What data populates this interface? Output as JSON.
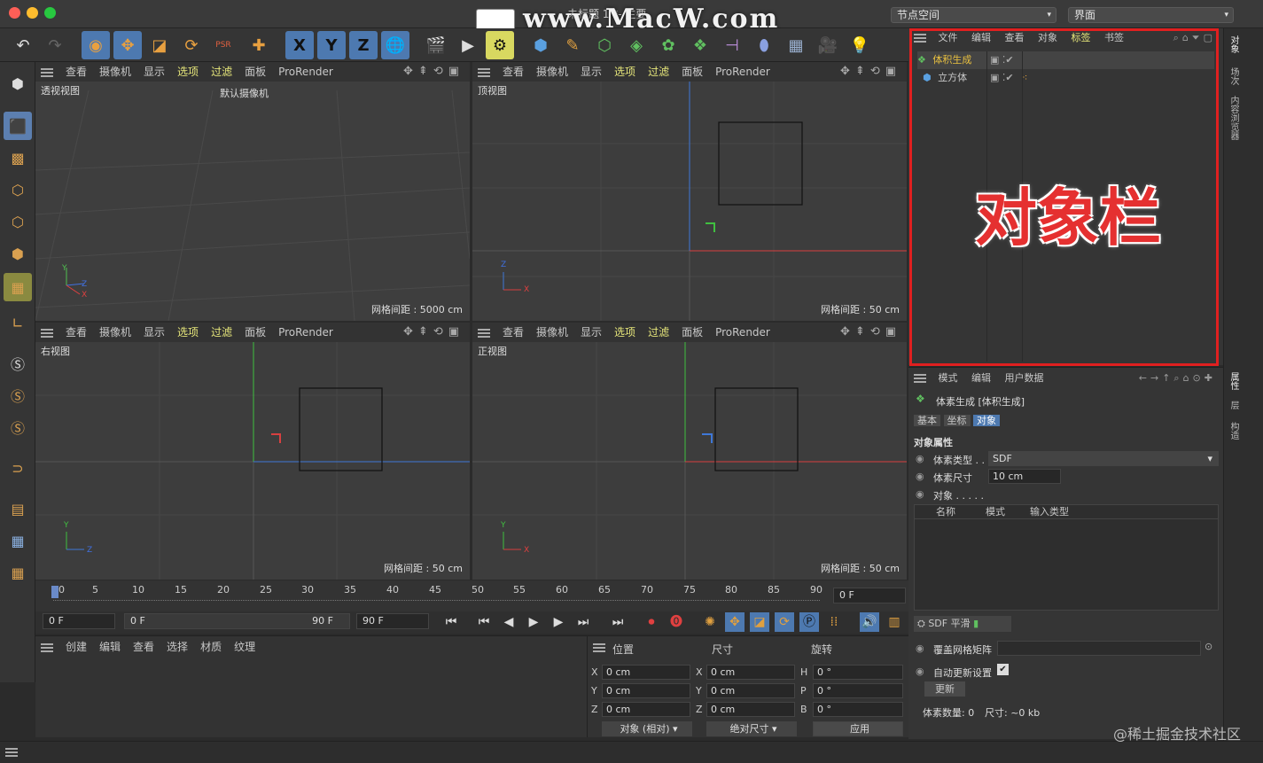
{
  "window": {
    "title": "未标题 1 *- 主要",
    "watermark": "www.MacW.com"
  },
  "header": {
    "node_space": "节点空间",
    "layout": "界面"
  },
  "toolbar": {
    "psr_label": "PSR",
    "x_axis": "X",
    "y_axis": "Y",
    "z_axis": "Z"
  },
  "viewports": [
    {
      "menu": [
        "查看",
        "摄像机",
        "显示",
        "选项",
        "过滤",
        "面板",
        "ProRender"
      ],
      "name": "透视视图",
      "camera": "默认摄像机",
      "grid": "网格间距 : 5000 cm"
    },
    {
      "menu": [
        "查看",
        "摄像机",
        "显示",
        "选项",
        "过滤",
        "面板",
        "ProRender"
      ],
      "name": "顶视图",
      "grid": "网格间距 : 50 cm"
    },
    {
      "menu": [
        "查看",
        "摄像机",
        "显示",
        "选项",
        "过滤",
        "面板",
        "ProRender"
      ],
      "name": "右视图",
      "grid": "网格间距 : 50 cm"
    },
    {
      "menu": [
        "查看",
        "摄像机",
        "显示",
        "选项",
        "过滤",
        "面板",
        "ProRender"
      ],
      "name": "正视图",
      "grid": "网格间距 : 50 cm"
    }
  ],
  "axes": {
    "x": "X",
    "y": "Y",
    "z": "Z"
  },
  "timeline": {
    "ticks": [
      "0",
      "5",
      "10",
      "15",
      "20",
      "25",
      "30",
      "35",
      "40",
      "45",
      "50",
      "55",
      "60",
      "65",
      "70",
      "75",
      "80",
      "85",
      "90"
    ],
    "current": "0 F"
  },
  "transport": {
    "start": "0 F",
    "range_start": "0 F",
    "range_end": "90 F",
    "end": "90 F"
  },
  "material": {
    "menu": [
      "创建",
      "编辑",
      "查看",
      "选择",
      "材质",
      "纹理"
    ]
  },
  "coords": {
    "headers": [
      "位置",
      "尺寸",
      "旋转"
    ],
    "pos": [
      "0 cm",
      "0 cm",
      "0 cm"
    ],
    "size": [
      "0 cm",
      "0 cm",
      "0 cm"
    ],
    "rot": [
      "0 °",
      "0 °",
      "0 °"
    ],
    "rot_labels": [
      "H",
      "P",
      "B"
    ],
    "mode1": "对象 (相对)",
    "mode2": "绝对尺寸",
    "apply": "应用"
  },
  "objects": {
    "menu": [
      "文件",
      "编辑",
      "查看",
      "对象",
      "标签",
      "书签"
    ],
    "items": [
      {
        "name": "体积生成"
      },
      {
        "name": "立方体"
      }
    ],
    "annotation": "对象栏"
  },
  "attributes": {
    "menu": [
      "模式",
      "编辑",
      "用户数据"
    ],
    "title": "体素生成 [体积生成]",
    "tabs": [
      "基本",
      "坐标",
      "对象"
    ],
    "section": "对象属性",
    "voxel_type_label": "体素类型 . .",
    "voxel_type": "SDF",
    "voxel_size_label": "体素尺寸",
    "voxel_size": "10 cm",
    "objects_label": "对象 . . . . .",
    "list_headers": [
      "名称",
      "模式",
      "输入类型"
    ],
    "sdf_smooth": "SDF 平滑",
    "cover_matrix": "覆盖网格矩阵",
    "auto_update": "自动更新设置",
    "update_btn": "更新",
    "voxel_count": "体素数量: 0",
    "size_info": "尺寸: ~0 kb"
  },
  "side_tabs": [
    "对象",
    "场次",
    "内容浏览器",
    "属性",
    "层",
    "构造"
  ],
  "footer": {
    "watermark": "@稀土掘金技术社区"
  }
}
